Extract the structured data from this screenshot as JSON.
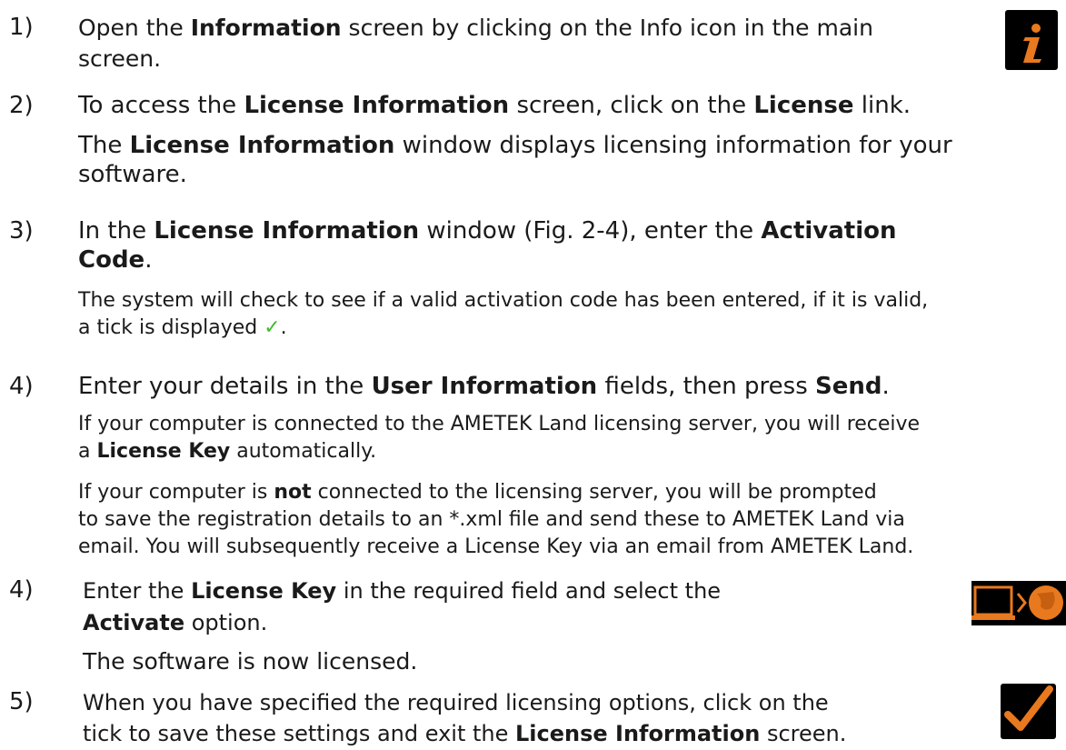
{
  "steps": [
    {
      "number": "1)",
      "lines": [
        [
          "Open the ",
          "Information",
          " screen by clicking on the Info icon in the main"
        ],
        [
          "screen."
        ]
      ],
      "icon": "info-icon"
    },
    {
      "number": "2)",
      "main": [
        "To access the ",
        "License Information",
        " screen, click on the ",
        "License",
        " link."
      ],
      "sub": [
        [
          "The ",
          "License Information",
          " window displays licensing information for your"
        ],
        [
          "software."
        ]
      ]
    },
    {
      "number": "3)",
      "main1": [
        "In the ",
        "License Information",
        " window (Fig. 2-4), enter the ",
        "Activation"
      ],
      "main2": [
        "Code",
        "."
      ],
      "note1": "The system will check to see if a valid activation code has been entered, if it is valid,",
      "note2": [
        "a tick is displayed ",
        "✓",
        "."
      ]
    },
    {
      "number": "4)",
      "main": [
        "Enter your details in the ",
        "User Information",
        " fields, then press ",
        "Send",
        "."
      ],
      "noteA1": "If your computer is connected to the AMETEK Land licensing server, you will receive",
      "noteA2": [
        "a ",
        "License Key",
        " automatically."
      ],
      "noteB1": [
        "If your computer is ",
        "not",
        " connected to the licensing server, you will be prompted"
      ],
      "noteB2": "to save the registration details to an *.xml file and send these to AMETEK Land via",
      "noteB3": "email. You will subsequently receive a License Key via an email from AMETEK Land."
    },
    {
      "number": "4)",
      "line1": [
        "Enter the ",
        "License Key",
        " in the required field and select the"
      ],
      "line2": [
        "Activate",
        " option."
      ],
      "after": "The software is now licensed.",
      "icon": "laptop-globe-icon"
    },
    {
      "number": "5)",
      "line1": "When you have specified the required licensing options, click on the",
      "line2": [
        "tick to save these settings and exit the ",
        "License Information",
        " screen."
      ],
      "icon": "tick-icon"
    }
  ],
  "colors": {
    "icon_orange": "#e8791e",
    "tick_green": "#3dbd2d",
    "icon_bg": "#000000"
  }
}
